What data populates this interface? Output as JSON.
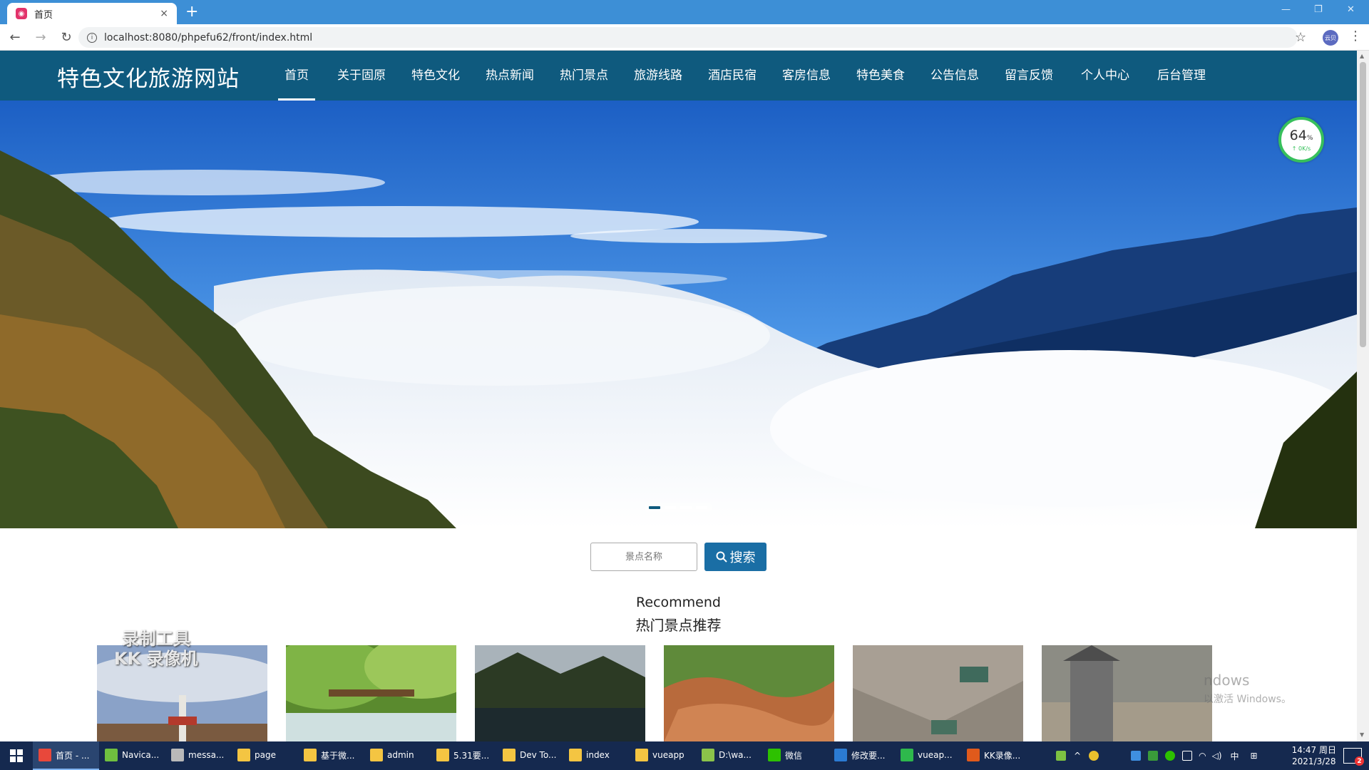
{
  "browser": {
    "tab_title": "首页",
    "tab_close": "×",
    "new_tab": "+",
    "url": "localhost:8080/phpefu62/front/index.html",
    "profile": "云贝",
    "window_controls": [
      "—",
      "❐",
      "✕"
    ]
  },
  "site": {
    "logo": "特色文化旅游网站",
    "nav": [
      "首页",
      "关于固原",
      "特色文化",
      "热点新闻",
      "热门景点",
      "旅游线路",
      "酒店民宿",
      "客房信息",
      "特色美食",
      "公告信息",
      "留言反馈",
      "个人中心",
      "后台管理"
    ],
    "active_nav": 0
  },
  "banner": {
    "slide_count": 4,
    "active_slide": 0
  },
  "speed_widget": {
    "percent": "64",
    "unit": "%",
    "rate": "↑ 0K/s"
  },
  "search": {
    "placeholder": "景点名称",
    "button_label": "搜索"
  },
  "recommend": {
    "title_en": "Recommend",
    "title_cn": "热门景点推荐",
    "cards": [
      {
        "scene": "monument-sky"
      },
      {
        "scene": "forest-bridge"
      },
      {
        "scene": "lake-mountain"
      },
      {
        "scene": "red-rocks"
      },
      {
        "scene": "temple-cliff"
      },
      {
        "scene": "gate-pillar"
      }
    ]
  },
  "overlays": {
    "watermark_line1": "录制工具",
    "watermark_line2": "KK 录像机",
    "windows_line1": "ndows",
    "windows_line2": "以激活 Windows。"
  },
  "taskbar": {
    "items": [
      {
        "label": "首页 - ...",
        "icon": "chrome-icon",
        "color": "#e8483b",
        "active": true
      },
      {
        "label": "Navica...",
        "icon": "navicat-icon",
        "color": "#6fbf3f"
      },
      {
        "label": "messa...",
        "icon": "app-icon",
        "color": "#b9b9b9"
      },
      {
        "label": "page",
        "icon": "folder-icon",
        "color": "#f4c542"
      },
      {
        "label": "基于微...",
        "icon": "folder-icon",
        "color": "#f4c542"
      },
      {
        "label": "admin",
        "icon": "folder-icon",
        "color": "#f4c542"
      },
      {
        "label": "5.31要...",
        "icon": "folder-icon",
        "color": "#f4c542"
      },
      {
        "label": "Dev To...",
        "icon": "folder-icon",
        "color": "#f4c542"
      },
      {
        "label": "index",
        "icon": "folder-icon",
        "color": "#f4c542"
      },
      {
        "label": "vueapp",
        "icon": "folder-icon",
        "color": "#f4c542"
      },
      {
        "label": "D:\\wa...",
        "icon": "notepad-icon",
        "color": "#8bc34a"
      },
      {
        "label": "微信",
        "icon": "wechat-icon",
        "color": "#2dc100"
      },
      {
        "label": "修改要...",
        "icon": "vscode-icon",
        "color": "#2b7bd3"
      },
      {
        "label": "vueap...",
        "icon": "hbuilder-icon",
        "color": "#2eb84c"
      },
      {
        "label": "KK录像...",
        "icon": "kk-icon",
        "color": "#e05a1c"
      }
    ],
    "ime": "中",
    "time": "14:47 周日",
    "date": "2021/3/28",
    "notifications": "2"
  }
}
